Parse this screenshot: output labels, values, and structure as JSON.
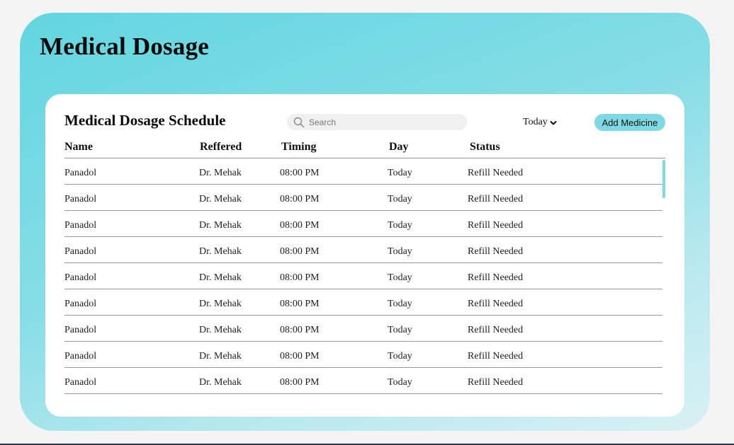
{
  "header": {
    "title": "Medical Dosage"
  },
  "schedule": {
    "title": "Medical Dosage Schedule",
    "search": {
      "placeholder": "Search",
      "value": ""
    },
    "day_filter": {
      "selected": "Today"
    },
    "add_button_label": "Add Medicine",
    "columns": [
      "Name",
      "Reffered",
      "Timing",
      "Day",
      "Status"
    ],
    "rows": [
      [
        "Panadol",
        "Dr. Mehak",
        "08:00 PM",
        "Today",
        "Refill Needed"
      ],
      [
        "Panadol",
        "Dr. Mehak",
        "08:00 PM",
        "Today",
        "Refill Needed"
      ],
      [
        "Panadol",
        "Dr. Mehak",
        "08:00 PM",
        "Today",
        "Refill Needed"
      ],
      [
        "Panadol",
        "Dr. Mehak",
        "08:00 PM",
        "Today",
        "Refill Needed"
      ],
      [
        "Panadol",
        "Dr. Mehak",
        "08:00 PM",
        "Today",
        "Refill Needed"
      ],
      [
        "Panadol",
        "Dr. Mehak",
        "08:00 PM",
        "Today",
        "Refill Needed"
      ],
      [
        "Panadol",
        "Dr. Mehak",
        "08:00 PM",
        "Today",
        "Refill Needed"
      ],
      [
        "Panadol",
        "Dr. Mehak",
        "08:00 PM",
        "Today",
        "Refill Needed"
      ],
      [
        "Panadol",
        "Dr. Mehak",
        "08:00 PM",
        "Today",
        "Refill Needed"
      ]
    ]
  },
  "colors": {
    "accent": "#7fd9e3",
    "gradient_start": "#62d6e0",
    "gradient_end": "#d8f1f3"
  },
  "icons": {
    "search": "search-icon",
    "dropdown": "chevron-down-icon"
  }
}
